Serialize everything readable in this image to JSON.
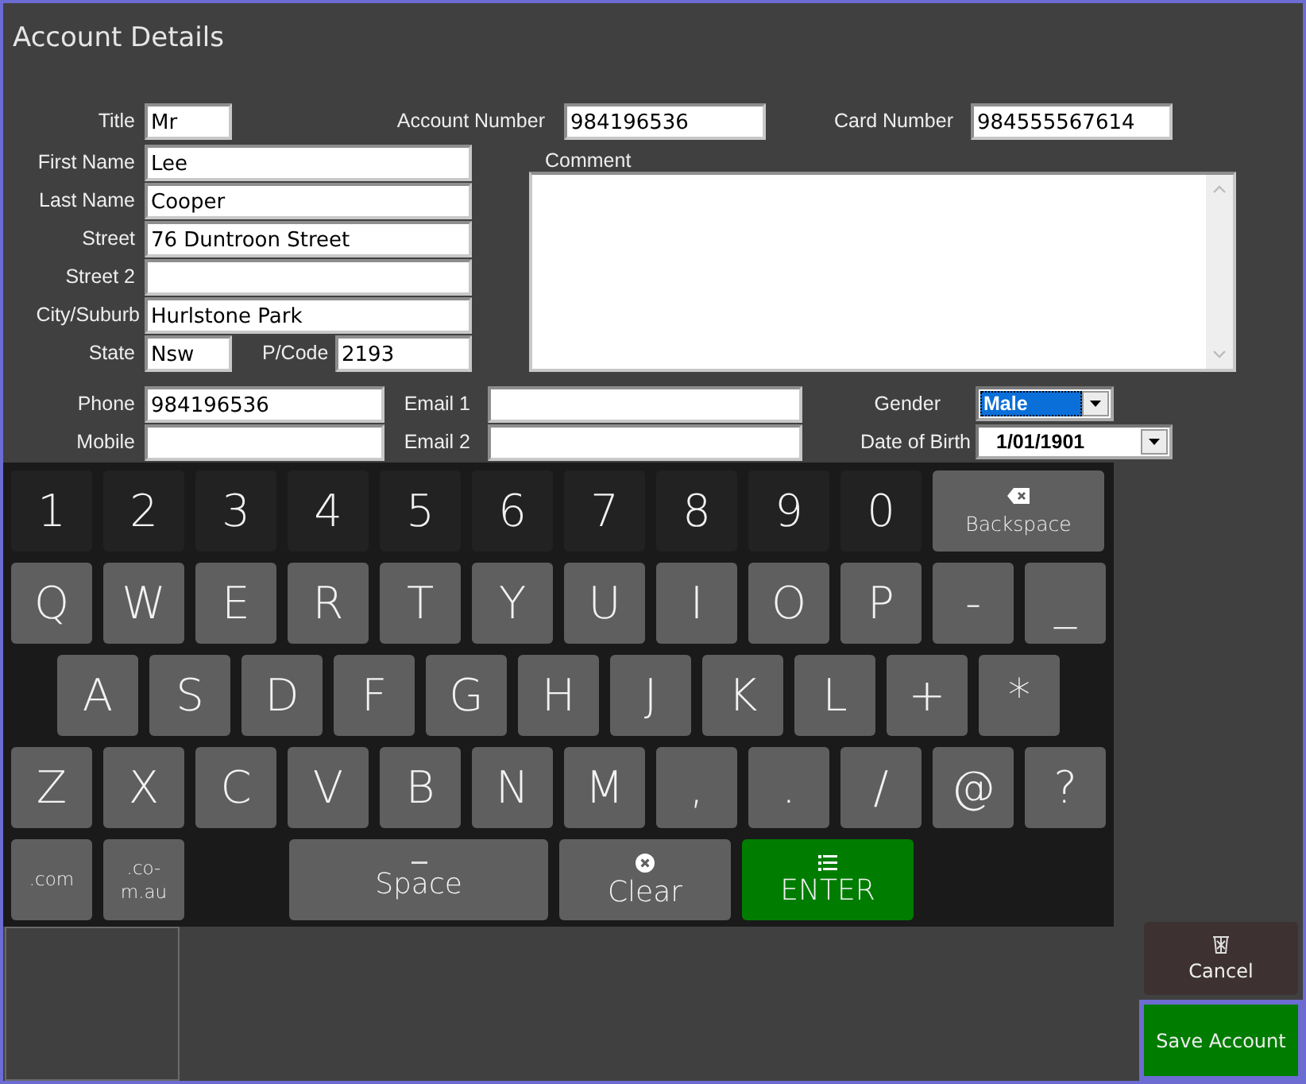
{
  "window": {
    "title": "Account Details"
  },
  "form": [
    {
      "kind": "text",
      "label": "Title",
      "value": "Mr"
    },
    {
      "kind": "text",
      "label": "Account Number",
      "value": "984196536"
    },
    {
      "kind": "text",
      "label": "Card Number",
      "value": "984555567614"
    },
    {
      "kind": "text",
      "label": "First Name",
      "value": "Lee"
    },
    {
      "kind": "comment",
      "label": "Comment"
    },
    {
      "kind": "text",
      "label": "Last Name",
      "value": "Cooper"
    },
    {
      "kind": "text",
      "label": "Street",
      "value": "76 Duntroon Street"
    },
    {
      "kind": "text",
      "label": "Street 2"
    },
    {
      "kind": "text",
      "label": "City/Suburb",
      "value": "Hurlstone Park"
    },
    {
      "kind": "text",
      "label": "State",
      "value": "Nsw"
    },
    {
      "kind": "text",
      "label": "P/Code",
      "value": "2193"
    },
    {
      "kind": "text",
      "label": "Phone",
      "value": "984196536"
    },
    {
      "kind": "text",
      "label": "Email 1"
    },
    {
      "kind": "dropdown",
      "label": "Gender",
      "value": "Male",
      "focused": true
    },
    {
      "kind": "text",
      "label": "Mobile"
    },
    {
      "kind": "text",
      "label": "Email 2"
    },
    {
      "kind": "dropdown",
      "label": "Date of Birth",
      "value": "1/01/1901",
      "focused": false
    }
  ],
  "keyboard": [
    [
      {
        "kind": "digit",
        "label": "1"
      },
      {
        "kind": "digit",
        "label": "2"
      },
      {
        "kind": "digit",
        "label": "3"
      },
      {
        "kind": "digit",
        "label": "4"
      },
      {
        "kind": "digit",
        "label": "5"
      },
      {
        "kind": "digit",
        "label": "6"
      },
      {
        "kind": "digit",
        "label": "7"
      },
      {
        "kind": "digit",
        "label": "8"
      },
      {
        "kind": "digit",
        "label": "9"
      },
      {
        "kind": "digit",
        "label": "0"
      },
      {
        "kind": "backspace",
        "label": "Backspace"
      }
    ],
    [
      {
        "kind": "char",
        "label": "Q"
      },
      {
        "kind": "char",
        "label": "W"
      },
      {
        "kind": "char",
        "label": "E"
      },
      {
        "kind": "char",
        "label": "R"
      },
      {
        "kind": "char",
        "label": "T"
      },
      {
        "kind": "char",
        "label": "Y"
      },
      {
        "kind": "char",
        "label": "U"
      },
      {
        "kind": "char",
        "label": "I"
      },
      {
        "kind": "char",
        "label": "O"
      },
      {
        "kind": "char",
        "label": "P"
      },
      {
        "kind": "char",
        "label": "-"
      },
      {
        "kind": "char",
        "label": "_"
      }
    ],
    [
      {
        "kind": "char",
        "label": "A"
      },
      {
        "kind": "char",
        "label": "S"
      },
      {
        "kind": "char",
        "label": "D"
      },
      {
        "kind": "char",
        "label": "F"
      },
      {
        "kind": "char",
        "label": "G"
      },
      {
        "kind": "char",
        "label": "H"
      },
      {
        "kind": "char",
        "label": "J"
      },
      {
        "kind": "char",
        "label": "K"
      },
      {
        "kind": "char",
        "label": "L"
      },
      {
        "kind": "char",
        "label": "+"
      },
      {
        "kind": "char",
        "label": "*"
      }
    ],
    [
      {
        "kind": "char",
        "label": "Z"
      },
      {
        "kind": "char",
        "label": "X"
      },
      {
        "kind": "char",
        "label": "C"
      },
      {
        "kind": "char",
        "label": "V"
      },
      {
        "kind": "char",
        "label": "B"
      },
      {
        "kind": "char",
        "label": "N"
      },
      {
        "kind": "char",
        "label": "M"
      },
      {
        "kind": "char",
        "label": ","
      },
      {
        "kind": "char",
        "label": "."
      },
      {
        "kind": "char",
        "label": "/"
      },
      {
        "kind": "char",
        "label": "@"
      },
      {
        "kind": "char",
        "label": "?"
      }
    ],
    [
      {
        "kind": "domain",
        "label": ".com"
      },
      {
        "kind": "domain",
        "label": ".co-m.au"
      },
      {
        "kind": "space",
        "label": "Space"
      },
      {
        "kind": "clear",
        "label": "Clear"
      },
      {
        "kind": "enter",
        "label": "ENTER"
      }
    ]
  ],
  "actions": [
    {
      "kind": "cancel",
      "label": "Cancel"
    },
    {
      "kind": "save",
      "label": "Save Account",
      "focused": true
    }
  ]
}
